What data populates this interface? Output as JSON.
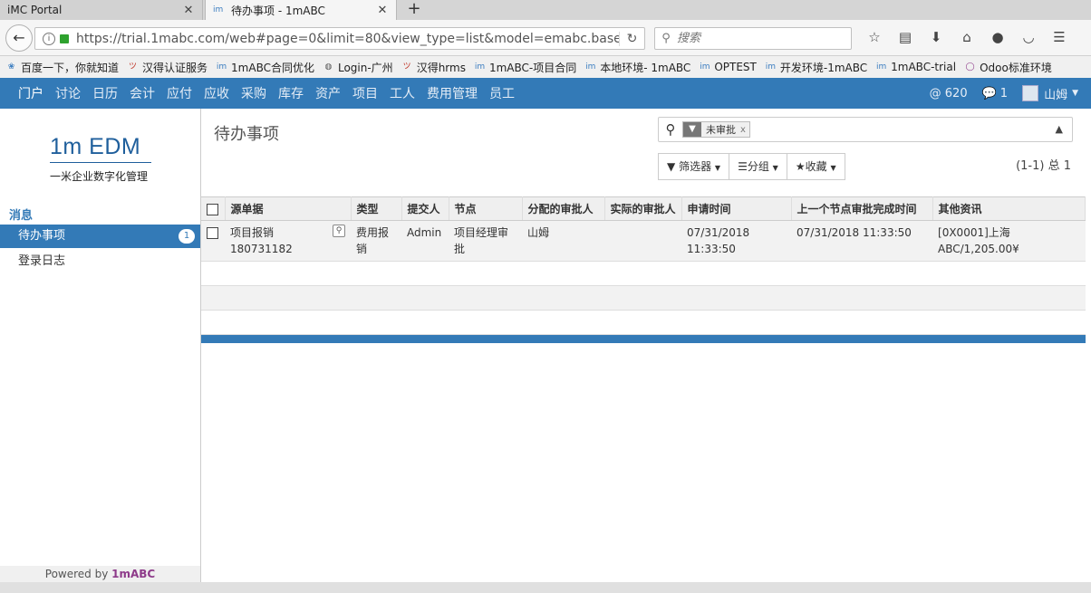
{
  "browser": {
    "tabs": [
      {
        "title": "iMC Portal",
        "active": false
      },
      {
        "title": "待办事项 - 1mABC",
        "active": true
      }
    ],
    "url": "https://trial.1mabc.com/web#page=0&limit=80&view_type=list&model=emabc.base",
    "search_placeholder": "搜索",
    "bookmarks": [
      "百度一下，你就知道",
      "汉得认证服务",
      "1mABC合同优化",
      "Login-广州",
      "汉得hrms",
      "1mABC-项目合同",
      "本地环境- 1mABC",
      "OPTEST",
      "开发环境-1mABC",
      "1mABC-trial",
      "Odoo标准环境"
    ]
  },
  "appbar": {
    "menu": [
      "门户",
      "讨论",
      "日历",
      "会计",
      "应付",
      "应收",
      "采购",
      "库存",
      "资产",
      "项目",
      "工人",
      "费用管理",
      "员工"
    ],
    "mentions": "@ 620",
    "messages": "1",
    "user": "山姆"
  },
  "sidebar": {
    "logo": "1m EDM",
    "logo_sub": "一米企业数字化管理",
    "section": "消息",
    "items": [
      {
        "label": "待办事项",
        "badge": "1"
      },
      {
        "label": "登录日志"
      }
    ],
    "powered_prefix": "Powered by ",
    "powered_brand": "1mABC"
  },
  "main": {
    "title": "待办事项",
    "facet": "未审批",
    "facet_remove": "x",
    "buttons": {
      "filters": "筛选器",
      "group": "分组",
      "favorites": "收藏"
    },
    "pager": "(1-1) 总 1",
    "columns": [
      "源单据",
      "类型",
      "提交人",
      "节点",
      "分配的审批人",
      "实际的审批人",
      "申请时间",
      "上一个节点审批完成时间",
      "其他资讯"
    ],
    "rows": [
      {
        "source_line1": "项目报销",
        "source_line2": "180731182",
        "type": "费用报销",
        "submitter": "Admin",
        "node": "项目经理审批",
        "assigned": "山姆",
        "actual": "",
        "apply_date": "07/31/2018",
        "apply_time": "11:33:50",
        "last_done": "07/31/2018 11:33:50",
        "info_line1": "[0X0001]上海",
        "info_line2": "ABC/1,205.00¥"
      }
    ]
  }
}
